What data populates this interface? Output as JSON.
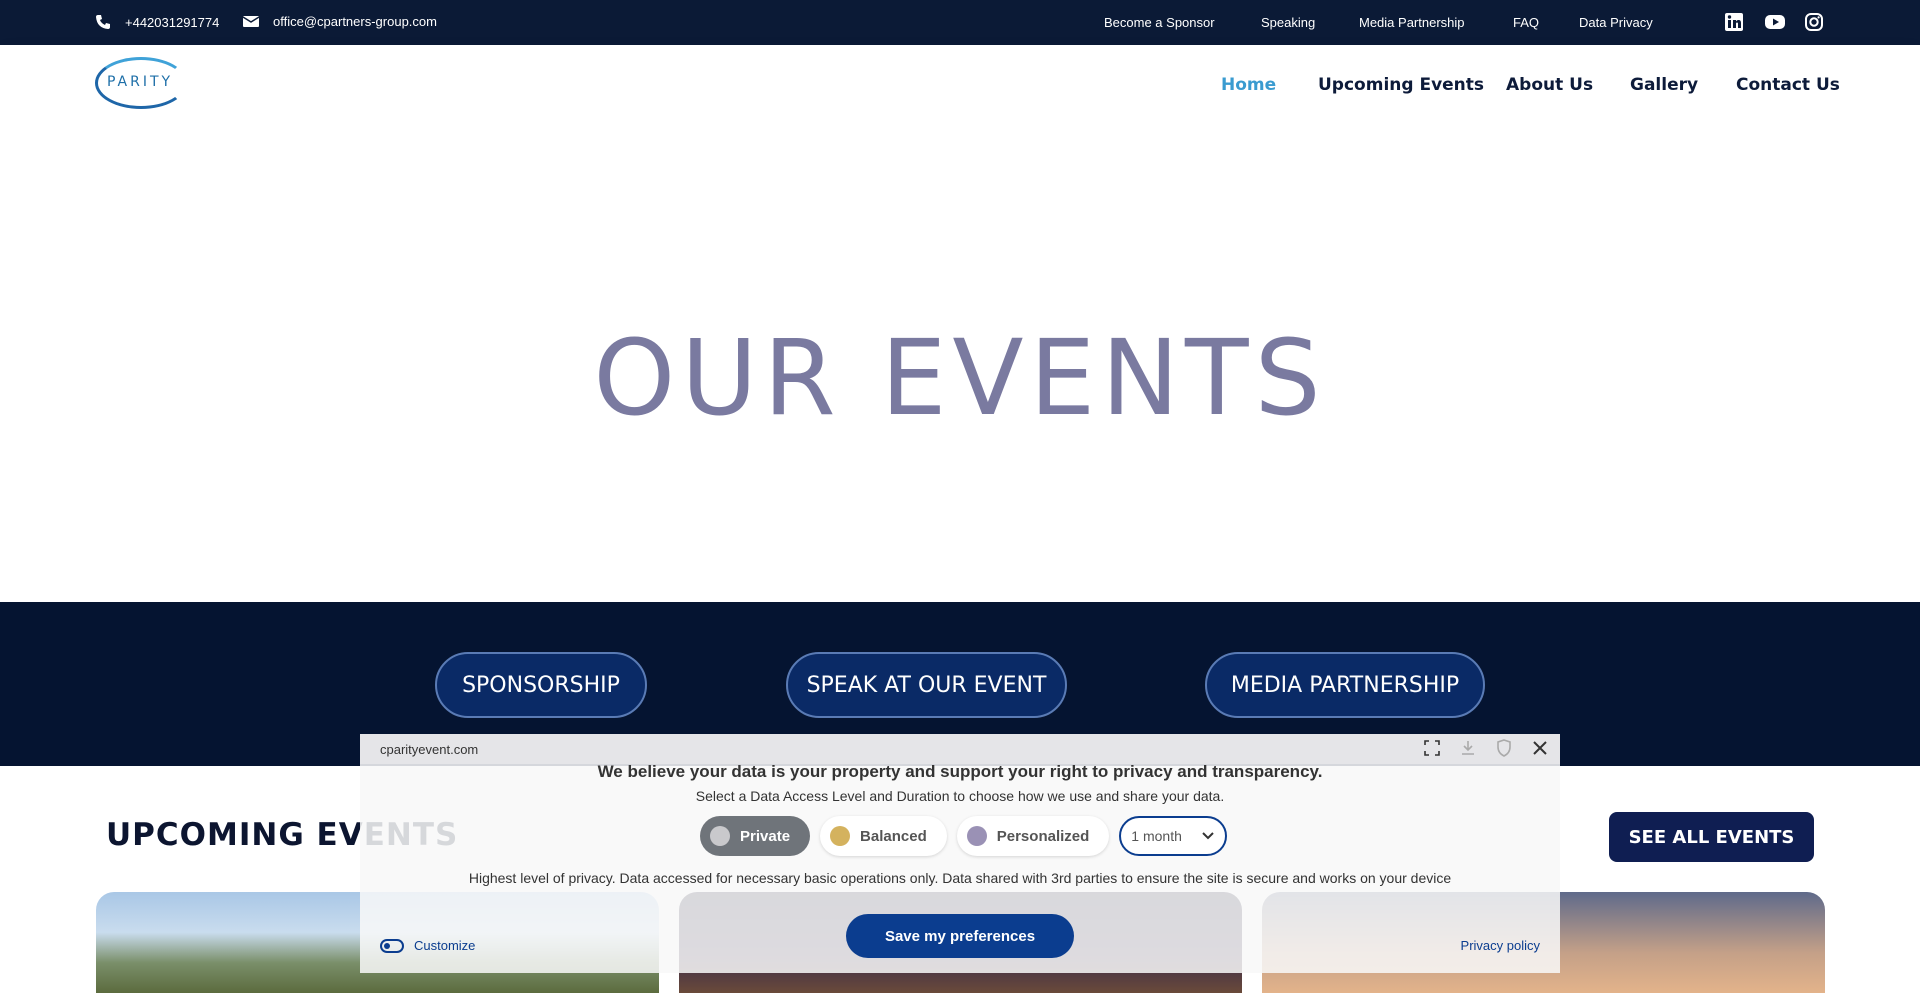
{
  "topbar": {
    "phone": "+442031291774",
    "email": "office@cpartners-group.com",
    "links": [
      "Become a Sponsor",
      "Speaking",
      "Media Partnership",
      "FAQ",
      "Data Privacy"
    ],
    "social": [
      "linkedin-icon",
      "youtube-icon",
      "instagram-icon"
    ]
  },
  "nav": {
    "logo_text": "PARITY",
    "items": [
      "Home",
      "Upcoming Events",
      "About Us",
      "Gallery",
      "Contact Us"
    ],
    "active": "Home"
  },
  "hero": {
    "title": "OUR EVENTS"
  },
  "band": {
    "buttons": [
      "SPONSORSHIP",
      "SPEAK AT OUR EVENT",
      "MEDIA PARTNERSHIP"
    ]
  },
  "upcoming": {
    "title": "UPCOMING EVENTS",
    "see_all": "SEE ALL EVENTS"
  },
  "consent": {
    "domain": "cparityevent.com",
    "headline": "We believe your data is your property and support your right to privacy and transparency.",
    "sub": "Select a Data Access Level and Duration to choose how we use and share your data.",
    "options": [
      {
        "label": "Private",
        "color": "#c9c9cc",
        "selected": true
      },
      {
        "label": "Balanced",
        "color": "#d4b25e",
        "selected": false
      },
      {
        "label": "Personalized",
        "color": "#9a91b5",
        "selected": false
      }
    ],
    "duration": "1 month",
    "description": "Highest level of privacy. Data accessed for necessary basic operations only. Data shared with 3rd parties to ensure the site is secure and works on your device",
    "save": "Save my preferences",
    "customize": "Customize",
    "policy": "Privacy policy"
  },
  "colors": {
    "topbar": "#0b1a36",
    "band": "#051431",
    "accent": "#3a9bd0",
    "consent_primary": "#0b3d8f"
  }
}
